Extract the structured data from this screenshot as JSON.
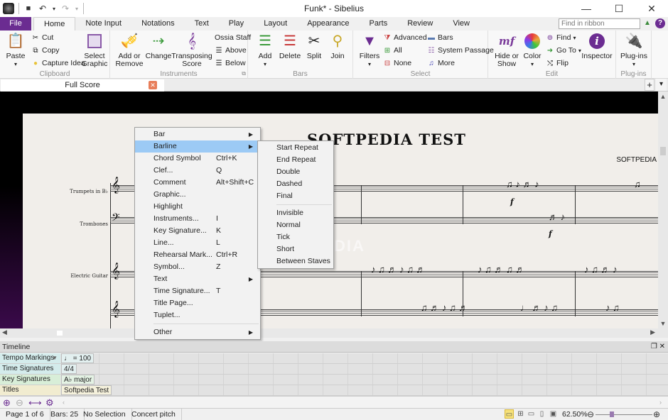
{
  "window": {
    "title": "Funk* - Sibelius",
    "controls": {
      "minimize": "—",
      "maximize": "☐",
      "close": "✕"
    }
  },
  "quick_access": {
    "save_icon": "💾",
    "undo_icon": "↶",
    "redo_icon": "↷",
    "dropdown": "▾"
  },
  "tabs": [
    {
      "label": "File"
    },
    {
      "label": "Home"
    },
    {
      "label": "Note Input"
    },
    {
      "label": "Notations"
    },
    {
      "label": "Text"
    },
    {
      "label": "Play"
    },
    {
      "label": "Layout"
    },
    {
      "label": "Appearance"
    },
    {
      "label": "Parts"
    },
    {
      "label": "Review"
    },
    {
      "label": "View"
    }
  ],
  "find_in_ribbon": {
    "placeholder": "Find in ribbon"
  },
  "ribbon": {
    "clipboard": {
      "label": "Clipboard",
      "paste": "Paste",
      "cut": "Cut",
      "copy": "Copy",
      "capture_idea": "Capture Idea",
      "select_graphic_1": "Select",
      "select_graphic_2": "Graphic"
    },
    "instruments": {
      "label": "Instruments",
      "add_remove_1": "Add or",
      "add_remove_2": "Remove",
      "change": "Change",
      "transposing_1": "Transposing",
      "transposing_2": "Score",
      "ossia_staff": "Ossia Staff",
      "above": "Above",
      "below": "Below"
    },
    "bars": {
      "label": "Bars",
      "add": "Add",
      "delete": "Delete",
      "split": "Split",
      "join": "Join"
    },
    "select": {
      "label": "Select",
      "filters": "Filters",
      "advanced": "Advanced",
      "all": "All",
      "none": "None",
      "bars": "Bars",
      "system_passage": "System Passage",
      "more": "More"
    },
    "edit": {
      "label": "Edit",
      "hide_show_1": "Hide or",
      "hide_show_2": "Show",
      "color": "Color",
      "find": "Find",
      "go_to": "Go To",
      "flip": "Flip",
      "inspector": "Inspector"
    },
    "plugins": {
      "label": "Plug-ins",
      "plugins": "Plug-ins"
    }
  },
  "document_tab": {
    "label": "Full Score"
  },
  "score": {
    "title": "SOFTPEDIA TEST",
    "composer": "SOFTPEDIA",
    "instruments": [
      "Trumpets in B♭",
      "Trombones",
      "Electric Guitar"
    ],
    "dynamics": [
      "f",
      "f"
    ],
    "watermark": "SOFTPEDIA"
  },
  "context_menu": {
    "items": [
      {
        "label": "Bar",
        "shortcut": "",
        "submenu": true
      },
      {
        "label": "Barline",
        "shortcut": "",
        "submenu": true,
        "highlighted": true
      },
      {
        "label": "Chord Symbol",
        "shortcut": "Ctrl+K"
      },
      {
        "label": "Clef...",
        "shortcut": "Q"
      },
      {
        "label": "Comment",
        "shortcut": "Alt+Shift+C"
      },
      {
        "label": "Graphic...",
        "shortcut": ""
      },
      {
        "label": "Highlight",
        "shortcut": ""
      },
      {
        "label": "Instruments...",
        "shortcut": "I"
      },
      {
        "label": "Key Signature...",
        "shortcut": "K"
      },
      {
        "label": "Line...",
        "shortcut": "L"
      },
      {
        "label": "Rehearsal Mark...",
        "shortcut": "Ctrl+R"
      },
      {
        "label": "Symbol...",
        "shortcut": "Z"
      },
      {
        "label": "Text",
        "shortcut": "",
        "submenu": true
      },
      {
        "label": "Time Signature...",
        "shortcut": "T"
      },
      {
        "label": "Title Page...",
        "shortcut": ""
      },
      {
        "label": "Tuplet...",
        "shortcut": ""
      },
      {
        "label": "Other",
        "shortcut": "",
        "submenu": true
      }
    ]
  },
  "barline_submenu": {
    "items": [
      "Start Repeat",
      "End Repeat",
      "Double",
      "Dashed",
      "Final",
      "Invisible",
      "Normal",
      "Tick",
      "Short",
      "Between Staves"
    ]
  },
  "timeline": {
    "title": "Timeline",
    "rows": [
      {
        "label": "Tempo Markings",
        "value": "♩ = 100",
        "color": "#d4ecec",
        "dropdown": "▼"
      },
      {
        "label": "Time Signatures",
        "value": "4/4",
        "color": "#d4ecec"
      },
      {
        "label": "Key Signatures",
        "value": "A♭ major",
        "color": "#d8eed8"
      },
      {
        "label": "Titles",
        "value": "Softpedia Test",
        "color": "#f1ecd0"
      }
    ]
  },
  "status_bar": {
    "page": "Page 1 of 6",
    "bars": "Bars: 25",
    "selection": "No Selection",
    "pitch": "Concert pitch",
    "zoom": "62.50%"
  },
  "colors": {
    "accent": "#6b2c91",
    "menu_highlight": "#9ccaf5"
  }
}
